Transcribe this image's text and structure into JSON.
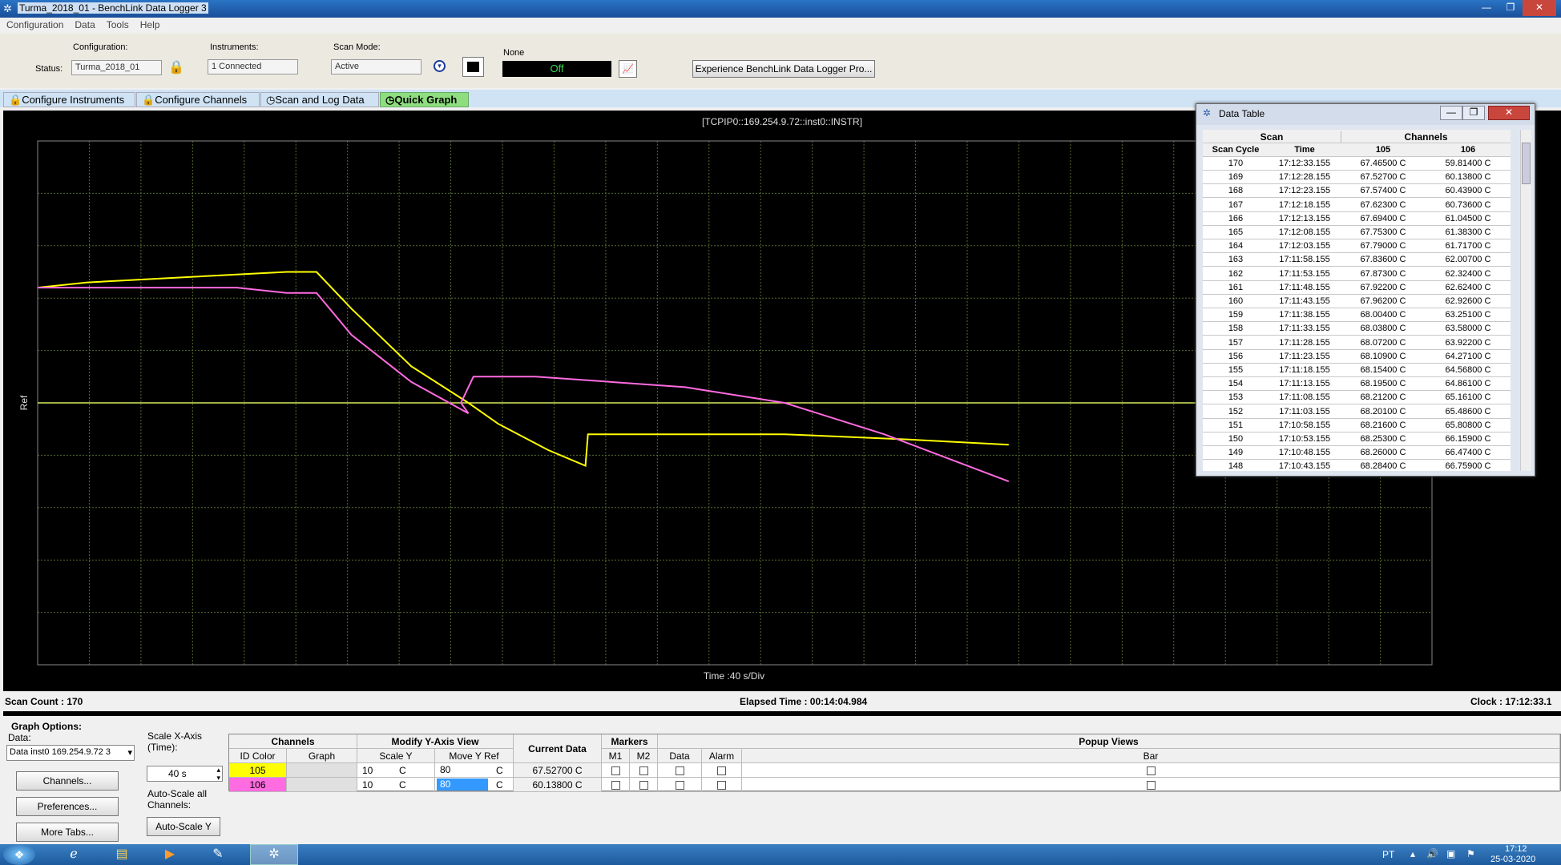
{
  "window": {
    "title": "Turma_2018_01 - BenchLink Data Logger 3",
    "min": "—",
    "max": "❐",
    "close": "✕"
  },
  "menu": [
    "Configuration",
    "Data",
    "Tools",
    "Help"
  ],
  "toolbar": {
    "configuration_label": "Configuration:",
    "status_label": "Status:",
    "configuration_value": "Turma_2018_01",
    "instruments_label": "Instruments:",
    "instruments_value": "1 Connected",
    "scanmode_label": "Scan Mode:",
    "scanmode_value": "Active",
    "alarm_label": "None",
    "alarm_value": "Off",
    "promo_button": "Experience BenchLink Data Logger Pro..."
  },
  "tabs": [
    {
      "label": "Configure Instruments"
    },
    {
      "label": "Configure Channels"
    },
    {
      "label": "Scan and Log Data"
    },
    {
      "label": "Quick Graph",
      "active": true
    }
  ],
  "graph": {
    "instrument": "[TCPIP0::169.254.9.72::inst0::INSTR]",
    "ylabel": "Ref",
    "xlabel": "Time :40 s/Div"
  },
  "chart_data": {
    "type": "line",
    "title": "[TCPIP0::169.254.9.72::inst0::INSTR]",
    "xlabel": "Time :40 s/Div",
    "ylabel": "Ref",
    "grid": true,
    "xlim": [
      0,
      560
    ],
    "ylim": [
      30,
      130
    ],
    "series": [
      {
        "name": "105",
        "color": "#ffff00",
        "x": [
          0,
          20,
          60,
          100,
          112,
          126,
          150,
          173,
          185,
          205,
          220,
          221,
          250,
          300,
          350,
          390
        ],
        "y": [
          102,
          103,
          104,
          105,
          105,
          98,
          87,
          80,
          76,
          71,
          68,
          74,
          74,
          74,
          73,
          72
        ]
      },
      {
        "name": "106",
        "color": "#ff6be0",
        "x": [
          0,
          40,
          80,
          100,
          112,
          126,
          150,
          173,
          170,
          175,
          200,
          230,
          260,
          300,
          340,
          390
        ],
        "y": [
          102,
          102,
          102,
          101,
          101,
          93,
          84,
          78,
          80,
          85,
          85,
          84,
          83,
          80,
          74,
          65
        ]
      }
    ]
  },
  "data_table": {
    "title": "Data Table",
    "scan_header": "Scan",
    "channels_header": "Channels",
    "columns": [
      "Scan Cycle",
      "Time",
      "105",
      "106"
    ],
    "rows": [
      [
        "170",
        "17:12:33.155",
        "67.46500 C",
        "59.81400 C"
      ],
      [
        "169",
        "17:12:28.155",
        "67.52700 C",
        "60.13800 C"
      ],
      [
        "168",
        "17:12:23.155",
        "67.57400 C",
        "60.43900 C"
      ],
      [
        "167",
        "17:12:18.155",
        "67.62300 C",
        "60.73600 C"
      ],
      [
        "166",
        "17:12:13.155",
        "67.69400 C",
        "61.04500 C"
      ],
      [
        "165",
        "17:12:08.155",
        "67.75300 C",
        "61.38300 C"
      ],
      [
        "164",
        "17:12:03.155",
        "67.79000 C",
        "61.71700 C"
      ],
      [
        "163",
        "17:11:58.155",
        "67.83600 C",
        "62.00700 C"
      ],
      [
        "162",
        "17:11:53.155",
        "67.87300 C",
        "62.32400 C"
      ],
      [
        "161",
        "17:11:48.155",
        "67.92200 C",
        "62.62400 C"
      ],
      [
        "160",
        "17:11:43.155",
        "67.96200 C",
        "62.92600 C"
      ],
      [
        "159",
        "17:11:38.155",
        "68.00400 C",
        "63.25100 C"
      ],
      [
        "158",
        "17:11:33.155",
        "68.03800 C",
        "63.58000 C"
      ],
      [
        "157",
        "17:11:28.155",
        "68.07200 C",
        "63.92200 C"
      ],
      [
        "156",
        "17:11:23.155",
        "68.10900 C",
        "64.27100 C"
      ],
      [
        "155",
        "17:11:18.155",
        "68.15400 C",
        "64.56800 C"
      ],
      [
        "154",
        "17:11:13.155",
        "68.19500 C",
        "64.86100 C"
      ],
      [
        "153",
        "17:11:08.155",
        "68.21200 C",
        "65.16100 C"
      ],
      [
        "152",
        "17:11:03.155",
        "68.20100 C",
        "65.48600 C"
      ],
      [
        "151",
        "17:10:58.155",
        "68.21600 C",
        "65.80800 C"
      ],
      [
        "150",
        "17:10:53.155",
        "68.25300 C",
        "66.15900 C"
      ],
      [
        "149",
        "17:10:48.155",
        "68.26000 C",
        "66.47400 C"
      ],
      [
        "148",
        "17:10:43.155",
        "68.28400 C",
        "66.75900 C"
      ]
    ]
  },
  "status": {
    "scan_count": "Scan Count :   170",
    "elapsed": "Elapsed Time :   00:14:04.984",
    "clock": "Clock :   17:12:33.1"
  },
  "graph_options": {
    "title": "Graph Options:",
    "data_label": "Data:",
    "data_value": "Data inst0 169.254.9.72 3",
    "channels_btn": "Channels...",
    "preferences_btn": "Preferences...",
    "moretabs_btn": "More Tabs...",
    "scalex_label": "Scale X-Axis (Time):",
    "scalex_value": "40 s",
    "autoscale_label": "Auto-Scale all Channels:",
    "autoscale_btn": "Auto-Scale Y"
  },
  "channel_grid": {
    "channels_hdr": "Channels",
    "modify_hdr": "Modify Y-Axis View",
    "current_hdr": "Current Data",
    "markers_hdr": "Markers",
    "popup_hdr": "Popup Views",
    "sub": [
      "ID Color",
      "Graph",
      "Scale Y",
      "Move Y Ref",
      "M1",
      "M2",
      "Data",
      "Alarm",
      "Bar"
    ],
    "rows": [
      {
        "id": "105",
        "color": "#ffff00",
        "scale": "10",
        "unit1": "C",
        "ref": "80",
        "unit2": "C",
        "current": "67.52700 C"
      },
      {
        "id": "106",
        "color": "#ff6be0",
        "scale": "10",
        "unit1": "C",
        "ref": "80",
        "unit2": "C",
        "current": "60.13800 C"
      }
    ]
  },
  "taskbar": {
    "lang": "PT",
    "time": "17:12",
    "date": "25-03-2020"
  }
}
